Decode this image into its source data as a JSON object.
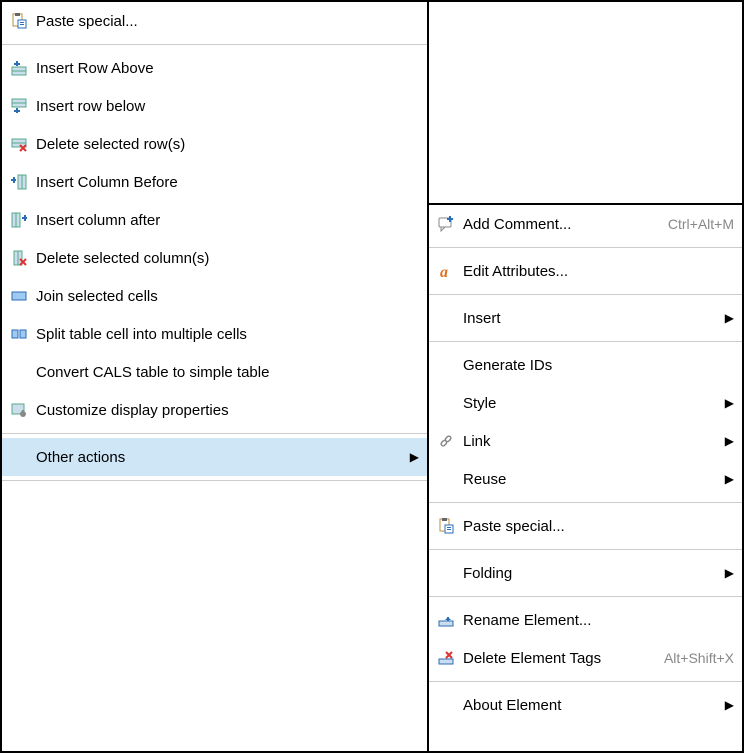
{
  "leftMenu": {
    "items": [
      {
        "label": "Paste special..."
      },
      {
        "label": "Insert Row Above"
      },
      {
        "label": "Insert row below"
      },
      {
        "label": "Delete selected row(s)"
      },
      {
        "label": "Insert Column Before"
      },
      {
        "label": "Insert column after"
      },
      {
        "label": "Delete selected column(s)"
      },
      {
        "label": "Join selected cells"
      },
      {
        "label": "Split table cell into multiple cells"
      },
      {
        "label": "Convert CALS table to simple table"
      },
      {
        "label": "Customize display properties"
      },
      {
        "label": "Other actions"
      }
    ]
  },
  "rightMenu": {
    "items": [
      {
        "label": "Add Comment...",
        "shortcut": "Ctrl+Alt+M"
      },
      {
        "label": "Edit Attributes..."
      },
      {
        "label": "Insert"
      },
      {
        "label": "Generate IDs"
      },
      {
        "label": "Style"
      },
      {
        "label": "Link"
      },
      {
        "label": "Reuse"
      },
      {
        "label": "Paste special..."
      },
      {
        "label": "Folding"
      },
      {
        "label": "Rename Element..."
      },
      {
        "label": "Delete Element Tags",
        "shortcut": "Alt+Shift+X"
      },
      {
        "label": "About Element"
      }
    ]
  }
}
